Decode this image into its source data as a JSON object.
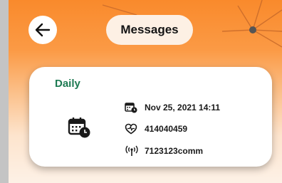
{
  "header": {
    "title": "Messages"
  },
  "card": {
    "label": "Daily",
    "datetime": "Nov 25, 2021 14:11",
    "health_id": "414040459",
    "device_id": "7123123comm"
  },
  "icons": {
    "back": "arrow-left-icon",
    "main": "calendar-clock-icon",
    "datetime": "calendar-clock-icon",
    "health": "heart-pulse-icon",
    "device": "antenna-signal-icon"
  },
  "colors": {
    "header_orange": "#f98a2c",
    "label_green": "#1d7a52"
  }
}
